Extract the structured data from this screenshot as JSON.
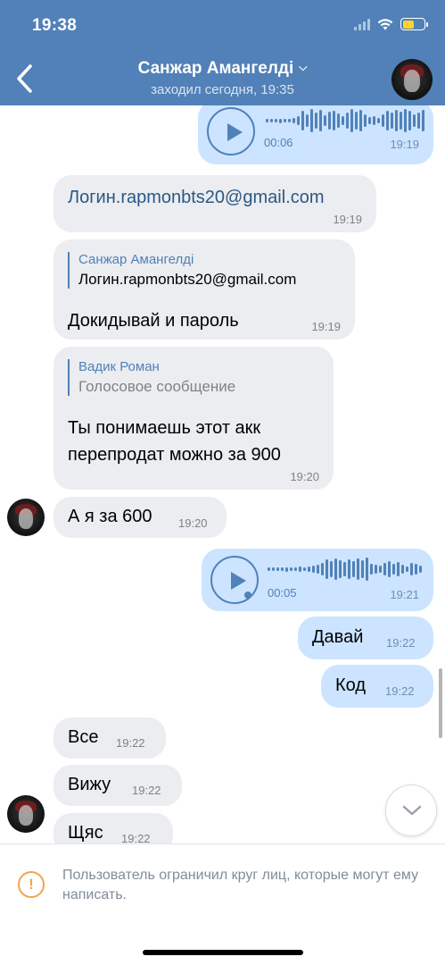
{
  "status_bar": {
    "time": "19:38",
    "icons": [
      "signal-icon",
      "wifi-icon",
      "battery-charging-icon"
    ]
  },
  "header": {
    "name": "Санжар Амангелді",
    "last_seen": "заходил сегодня, 19:35",
    "back_icon": "chevron-left-icon",
    "dropdown_icon": "chevron-down-icon",
    "bg_color": "#5181b8"
  },
  "messages": {
    "voice1": {
      "duration": "00:06",
      "time": "19:19"
    },
    "m1": {
      "text": "Логин.rapmonbts20@gmail.com",
      "time": "19:19"
    },
    "m2": {
      "reply_name": "Санжар Амангелді",
      "reply_text": "Логин.rapmonbts20@gmail.com",
      "text": "Докидывай и пароль",
      "time": "19:19"
    },
    "m3": {
      "reply_name": "Вадик Роман",
      "reply_text": "Голосовое сообщение",
      "text_line1": "Ты понимаешь этот акк",
      "text_line2": "перепродат можно за 900",
      "time": "19:20"
    },
    "m4": {
      "text": "А я за 600",
      "time": "19:20"
    },
    "voice2": {
      "duration": "00:05",
      "time": "19:21"
    },
    "m5": {
      "text": "Давай",
      "time": "19:22"
    },
    "m6": {
      "text": "Код",
      "time": "19:22"
    },
    "m7": {
      "text": "Все",
      "time": "19:22"
    },
    "m8": {
      "text": "Вижу",
      "time": "19:22"
    },
    "m9": {
      "text": "Щяс",
      "time": "19:22"
    }
  },
  "footer": {
    "restriction_text": "Пользователь ограничил круг лиц, которые могут ему написать.",
    "warning_icon": "exclamation-circle-icon",
    "warning_color": "#f0a44e"
  },
  "colors": {
    "outgoing_bubble": "#cce4ff",
    "incoming_bubble": "#ebedf0",
    "accent": "#5181b8"
  }
}
